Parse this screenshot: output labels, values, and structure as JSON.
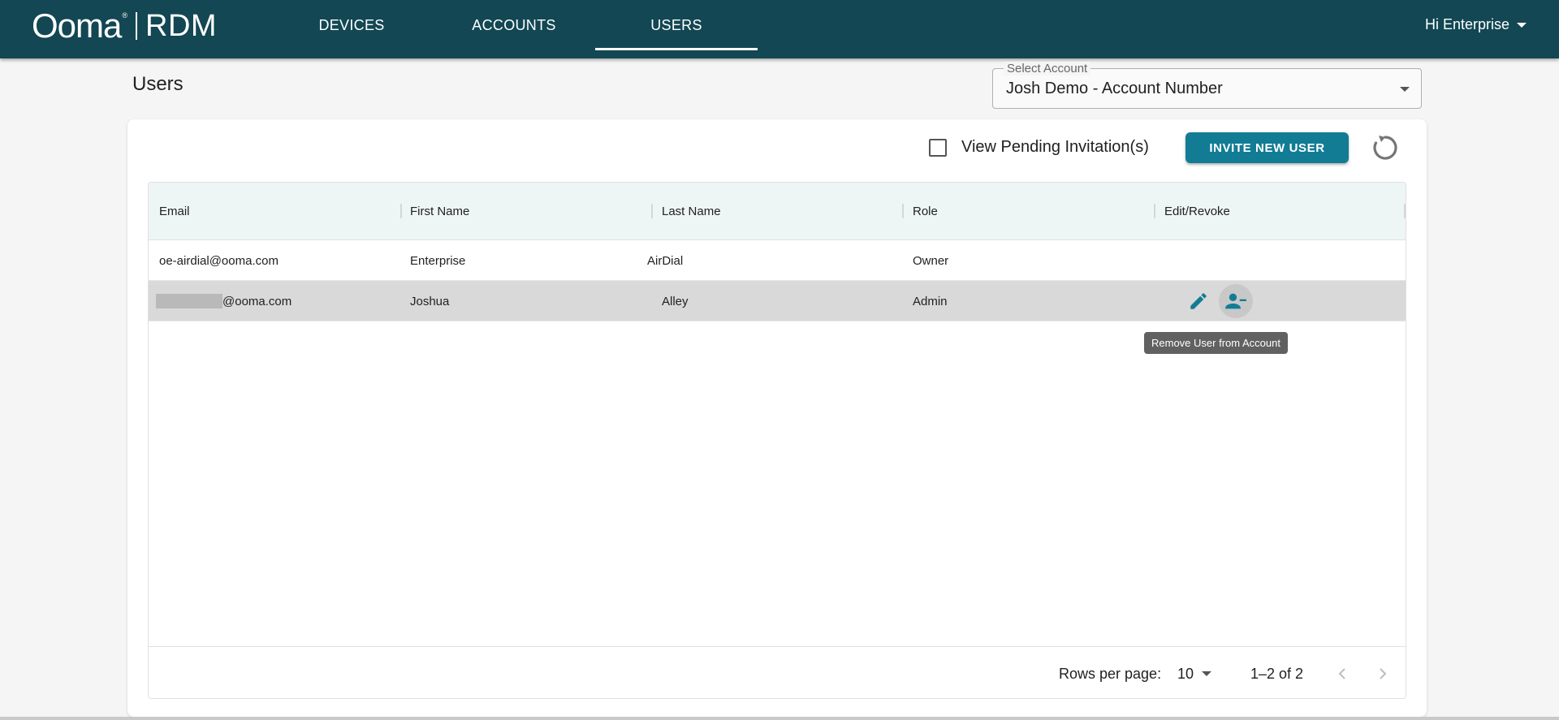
{
  "app": {
    "logo_ooma": "Ooma",
    "logo_reg": "®",
    "logo_product": "RDM",
    "greeting": "Hi Enterprise"
  },
  "nav": {
    "tabs": [
      {
        "label": "DEVICES",
        "active": false
      },
      {
        "label": "ACCOUNTS",
        "active": false
      },
      {
        "label": "USERS",
        "active": true
      }
    ]
  },
  "page": {
    "title": "Users",
    "account_select": {
      "label": "Select Account",
      "value": "Josh Demo - Account Number"
    }
  },
  "toolbar": {
    "pending_label": "View Pending Invitation(s)",
    "pending_checked": false,
    "invite_label": "INVITE NEW USER",
    "refresh_icon": "refresh-icon"
  },
  "table": {
    "columns": [
      "Email",
      "First Name",
      "Last Name",
      "Role",
      "Edit/Revoke"
    ],
    "rows": [
      {
        "email": "oe-airdial@ooma.com",
        "first_name": "Enterprise",
        "last_name": "AirDial",
        "role": "Owner"
      },
      {
        "email": "@ooma.com",
        "first_name": "Joshua",
        "last_name": "Alley",
        "role": "Admin"
      }
    ],
    "tooltip": "Remove User from Account",
    "footer": {
      "rows_per_page_label": "Rows per page:",
      "rows_per_page_value": "10",
      "page_range": "1–2 of 2"
    }
  },
  "colors": {
    "appbar": "#124753",
    "accent": "#127c95",
    "header_row": "#eef6f5",
    "selected_row": "#d9d9d9"
  }
}
